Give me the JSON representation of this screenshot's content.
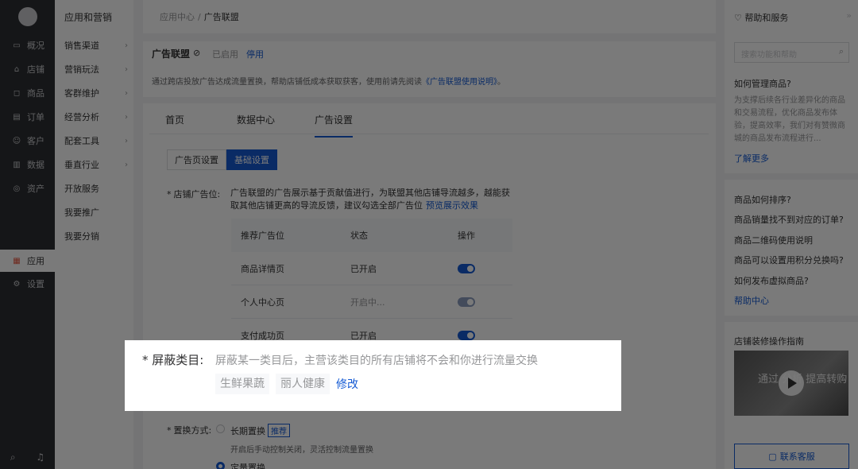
{
  "nav": {
    "items": [
      {
        "label": "概况",
        "icon": "monitor-icon",
        "glyph": "▭"
      },
      {
        "label": "店铺",
        "icon": "store-icon",
        "glyph": "⌂"
      },
      {
        "label": "商品",
        "icon": "bag-icon",
        "glyph": "◻"
      },
      {
        "label": "订单",
        "icon": "document-icon",
        "glyph": "▤"
      },
      {
        "label": "客户",
        "icon": "user-icon",
        "glyph": "☺"
      },
      {
        "label": "数据",
        "icon": "chart-icon",
        "glyph": "▥"
      },
      {
        "label": "资产",
        "icon": "coin-icon",
        "glyph": "◎"
      }
    ],
    "active": {
      "label": "应用",
      "icon": "grid-icon",
      "glyph": "▦"
    },
    "settings": {
      "label": "设置",
      "icon": "gear-icon",
      "glyph": "⚙"
    },
    "bottom": {
      "search_glyph": "⌕",
      "bell_glyph": "♫"
    }
  },
  "submenu": {
    "title": "应用和营销",
    "items": [
      {
        "label": "销售渠道",
        "chevron": "›"
      },
      {
        "label": "营销玩法",
        "chevron": "›"
      },
      {
        "label": "客群维护",
        "chevron": "›"
      },
      {
        "label": "经营分析",
        "chevron": "›"
      },
      {
        "label": "配套工具",
        "chevron": "›"
      },
      {
        "label": "垂直行业",
        "chevron": "›"
      },
      {
        "label": "开放服务",
        "chevron": ""
      },
      {
        "label": "我要推广",
        "chevron": ""
      },
      {
        "label": "我要分销",
        "chevron": ""
      }
    ]
  },
  "breadcrumb": {
    "root": "应用中心",
    "sep": "/",
    "current": "广告联盟"
  },
  "intro": {
    "title": "广告联盟",
    "check_glyph": "⊘",
    "status": "已启用",
    "stop": "停用",
    "desc_prefix": "通过跨店投放广告达成流量置换，帮助店铺低成本获取获客，使用前请先阅读",
    "desc_link": "《广告联盟使用说明》",
    "desc_suffix": "。"
  },
  "tabs": [
    "首页",
    "数据中心",
    "广告设置"
  ],
  "segment": {
    "left": "广告页设置",
    "right": "基础设置"
  },
  "ad_position": {
    "label": "店铺广告位:",
    "required": "*",
    "text": "广告联盟的广告展示基于贡献值进行，为联盟其他店铺导流越多，越能获取其他店铺更高的导流反馈，建议勾选全部广告位",
    "link": "预览展示效果"
  },
  "table": {
    "headers": [
      "推荐广告位",
      "状态",
      "操作"
    ],
    "rows": [
      {
        "name": "商品详情页",
        "status": "已开启",
        "toggle": "on"
      },
      {
        "name": "个人中心页",
        "status": "开启中...",
        "toggle": "disabled"
      },
      {
        "name": "支付成功页",
        "status": "已开启",
        "toggle": "on"
      }
    ]
  },
  "swap": {
    "label": "置换方式:",
    "required": "*",
    "opt1": "长期置换",
    "opt1_tag": "推荐",
    "opt1_hint": "开启后手动控制关闭，灵活控制流量置换",
    "opt2": "定量置换"
  },
  "popup": {
    "label": "* 屏蔽类目:",
    "desc": "屏蔽某一类目后，主营该类目的所有店铺将不会和你进行流量交换",
    "chips": [
      "生鲜果蔬",
      "丽人健康"
    ],
    "modify": "修改"
  },
  "help": {
    "title": "帮助和服务",
    "title_glyph": "♡",
    "collapse_glyph": "»",
    "search_placeholder": "搜索功能和帮助",
    "search_glyph": "⌕",
    "q1": "如何管理商品?",
    "p1": "为支撑后续各行业差异化的商品和交易流程，优化商品发布体验，提高效率，我们对有赞微商城的商品发布流程进行...",
    "more": "了解更多",
    "questions": [
      "商品如何排序?",
      "商品销量找不到对应的订单?",
      "商品二维码使用说明",
      "商品可以设置用积分兑换吗?",
      "如何发布虚拟商品?"
    ],
    "center": "帮助中心",
    "guide": "店铺装修操作指南",
    "video_text": "通过 分析 提高转购",
    "contact_glyph": "▢",
    "contact": "联系客服"
  }
}
